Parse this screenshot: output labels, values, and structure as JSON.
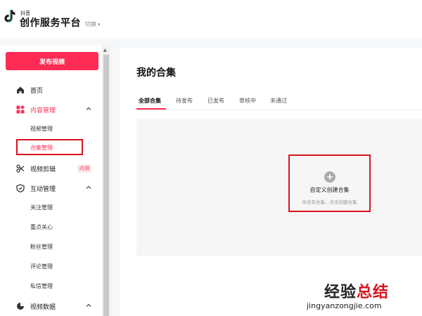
{
  "header": {
    "brand_small": "抖音",
    "brand_title": "创作服务平台",
    "switch_label": "切换"
  },
  "sidebar": {
    "publish_label": "发布视频",
    "home": "首页",
    "content_mgmt": "内容管理",
    "content_sub": [
      "视频管理",
      "合集管理"
    ],
    "video_edit": "视频剪辑",
    "video_edit_badge": "内测",
    "interaction_mgmt": "互动管理",
    "interaction_sub": [
      "关注管理",
      "重点关心",
      "粉丝管理",
      "评论管理",
      "私信管理"
    ],
    "video_data": "视频数据"
  },
  "main": {
    "title": "我的合集",
    "tabs": [
      "全部合集",
      "待发布",
      "已发布",
      "审核中",
      "未通过"
    ],
    "create_title": "自定义创建合集",
    "create_sub": "你没有合集，点击创建合集"
  },
  "watermark": {
    "cn_a": "经验",
    "cn_b": "总结",
    "url": "jingyanzongjie.com"
  },
  "colors": {
    "accent": "#fe2c55",
    "highlight_box": "#d9131c"
  }
}
